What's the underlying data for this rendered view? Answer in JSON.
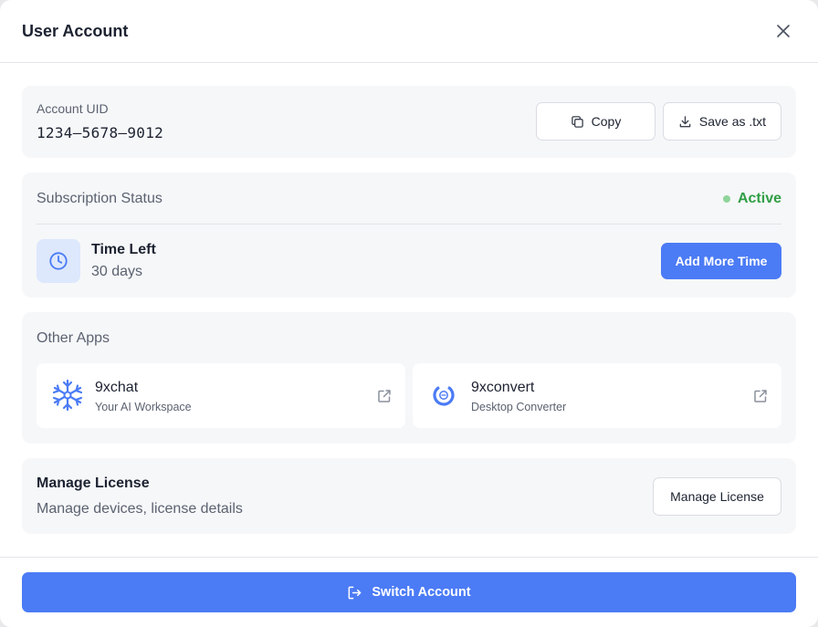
{
  "dialog": {
    "title": "User Account"
  },
  "uid": {
    "label": "Account UID",
    "value": "1234–5678–9012",
    "copy_label": "Copy",
    "save_label": "Save as .txt"
  },
  "subscription": {
    "label": "Subscription Status",
    "status": "Active",
    "status_color": "#2f9e44",
    "time_left_label": "Time Left",
    "time_left_value": "30 days",
    "add_time_label": "Add More Time"
  },
  "other_apps": {
    "label": "Other Apps",
    "apps": [
      {
        "name": "9xchat",
        "subtitle": "Your AI Workspace",
        "icon": "snowflake-logo-icon"
      },
      {
        "name": "9xconvert",
        "subtitle": "Desktop Converter",
        "icon": "convert-logo-icon"
      }
    ]
  },
  "license": {
    "title": "Manage License",
    "subtitle": "Manage devices, license details",
    "button_label": "Manage License"
  },
  "footer": {
    "switch_label": "Switch Account"
  },
  "colors": {
    "accent": "#4b7bf5",
    "card_bg": "#f6f7f9"
  }
}
